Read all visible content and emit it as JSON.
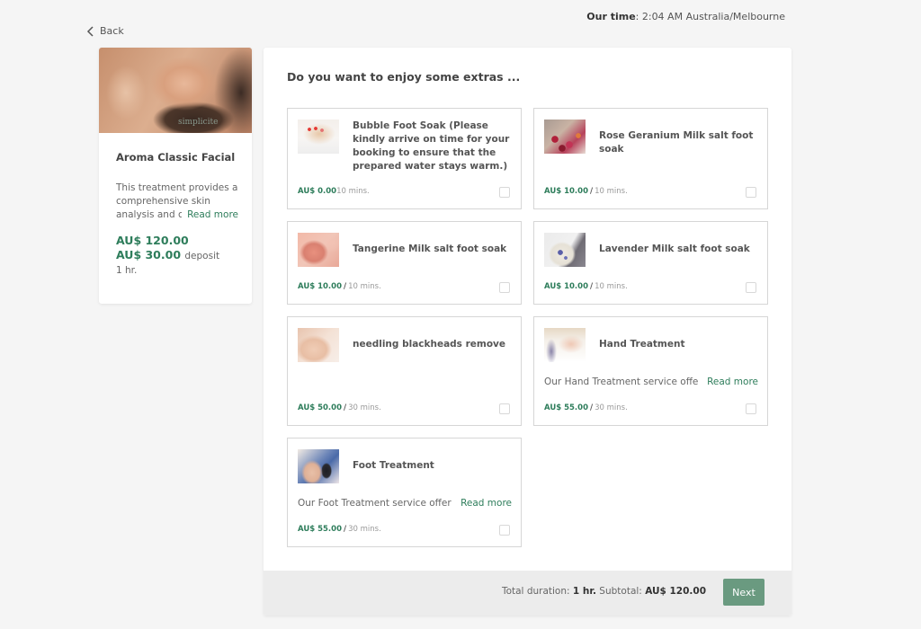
{
  "header": {
    "back_label": "Back",
    "our_time_label": "Our time",
    "our_time_value": ": 2:04 AM Australia/Melbourne"
  },
  "service": {
    "image_alt": "facial massage photo",
    "logo_text": "simplicite",
    "title": "Aroma Classic Facial",
    "description": "This treatment provides a comprehensive skin analysis and c",
    "read_more": "Read more",
    "price": "AU$ 120.00",
    "deposit_price": "AU$ 30.00",
    "deposit_label": "deposit",
    "duration": "1 hr."
  },
  "extras": {
    "title": "Do you want to enjoy some extras ...",
    "items": [
      {
        "name": "Bubble Foot Soak (Please kindly arrive on time for your booking to ensure that the prepared water stays warm.)",
        "description": "",
        "read_more": "",
        "price": "AU$ 0.00",
        "separator": "",
        "duration": "10 mins.",
        "checked": false,
        "thumb": "foot-soak"
      },
      {
        "name": "Rose Geranium Milk salt foot soak",
        "description": "",
        "read_more": "",
        "price": "AU$ 10.00",
        "separator": "/",
        "duration": "10 mins.",
        "checked": false,
        "thumb": "rose-petals"
      },
      {
        "name": "Tangerine Milk salt foot soak",
        "description": "",
        "read_more": "",
        "price": "AU$ 10.00",
        "separator": "/",
        "duration": "10 mins.",
        "checked": false,
        "thumb": "pink-salt"
      },
      {
        "name": "Lavender Milk salt foot soak",
        "description": "",
        "read_more": "",
        "price": "AU$ 10.00",
        "separator": "/",
        "duration": "10 mins.",
        "checked": false,
        "thumb": "lavender"
      },
      {
        "name": "needling blackheads remove",
        "description": "",
        "read_more": "",
        "price": "AU$ 50.00",
        "separator": "/",
        "duration": "30 mins.",
        "checked": false,
        "thumb": "facial-needling"
      },
      {
        "name": "Hand Treatment",
        "description": "Our Hand Treatment service offers a",
        "read_more": "Read more",
        "price": "AU$ 55.00",
        "separator": "/",
        "duration": "30 mins.",
        "checked": false,
        "thumb": "hands"
      },
      {
        "name": "Foot Treatment",
        "description": "Our Foot Treatment service offers a",
        "read_more": "Read more",
        "price": "AU$ 55.00",
        "separator": "/",
        "duration": "30 mins.",
        "checked": false,
        "thumb": "foot"
      }
    ]
  },
  "footer": {
    "total_duration_label": "Total duration:",
    "total_duration_value": "1 hr.",
    "subtotal_label": "Subtotal:",
    "subtotal_value": "AU$ 120.00",
    "next_label": "Next"
  },
  "colors": {
    "accent_green": "#2e7d5b",
    "button_green": "#6a9a80",
    "background": "#f5f5f5"
  }
}
